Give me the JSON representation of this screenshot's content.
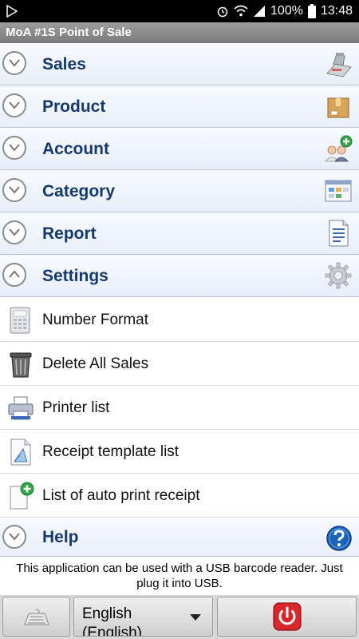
{
  "status_bar": {
    "battery": "100%",
    "time": "13:48"
  },
  "app_title": "MoA #1S Point of Sale",
  "categories": [
    {
      "label": "Sales",
      "state": "collapsed"
    },
    {
      "label": "Product",
      "state": "collapsed"
    },
    {
      "label": "Account",
      "state": "collapsed"
    },
    {
      "label": "Category",
      "state": "collapsed"
    },
    {
      "label": "Report",
      "state": "collapsed"
    },
    {
      "label": "Settings",
      "state": "expanded"
    },
    {
      "label": "Help",
      "state": "collapsed"
    }
  ],
  "settings_items": [
    {
      "label": "Number Format"
    },
    {
      "label": "Delete All Sales"
    },
    {
      "label": "Printer list"
    },
    {
      "label": "Receipt template list"
    },
    {
      "label": "List of auto print receipt"
    }
  ],
  "info_text": "This application can be used with a USB barcode reader. Just plug it into USB.",
  "language": {
    "selected": "English",
    "subtitle": "(English)"
  },
  "colors": {
    "category_text": "#163a6c",
    "power_red": "#d8262c",
    "help_blue": "#1a64b8"
  }
}
